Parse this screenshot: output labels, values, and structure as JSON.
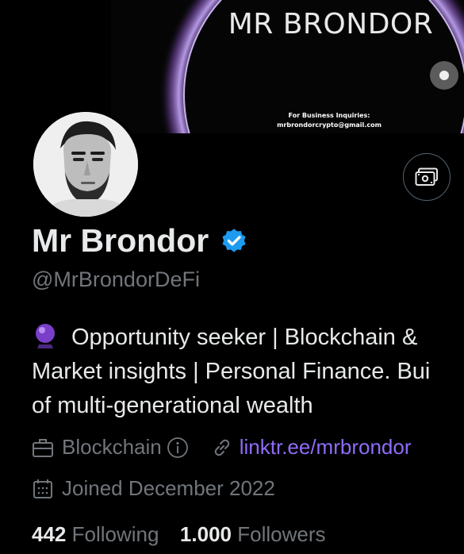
{
  "banner": {
    "title": "MR BRONDOR",
    "business_line1": "For Business Inquiries:",
    "business_line2": "mrbrondorcrypto@gmail.com"
  },
  "profile": {
    "name": "Mr Brondor",
    "handle": "@MrBrondorDeFi",
    "bio_line1": "Opportunity seeker | Blockchain &",
    "bio_line2": "Market insights | Personal Finance. Bui",
    "bio_line3": "of multi-generational wealth",
    "category": "Blockchain",
    "website": "linktr.ee/mrbrondor",
    "joined": "Joined December 2022",
    "following_count": "442",
    "following_label": "Following",
    "followers_count": "1.000",
    "followers_label": "Followers"
  },
  "icons": {
    "header_button": "money-bill-icon",
    "verified": "verified-badge-icon",
    "bio_emoji": "crystal-ball-icon",
    "category": "briefcase-icon",
    "info": "info-icon",
    "link": "link-icon",
    "calendar": "calendar-icon"
  },
  "colors": {
    "background": "#000000",
    "verified": "#1d9bf0",
    "link": "#8e6cf7",
    "secondary_text": "#71767b"
  }
}
